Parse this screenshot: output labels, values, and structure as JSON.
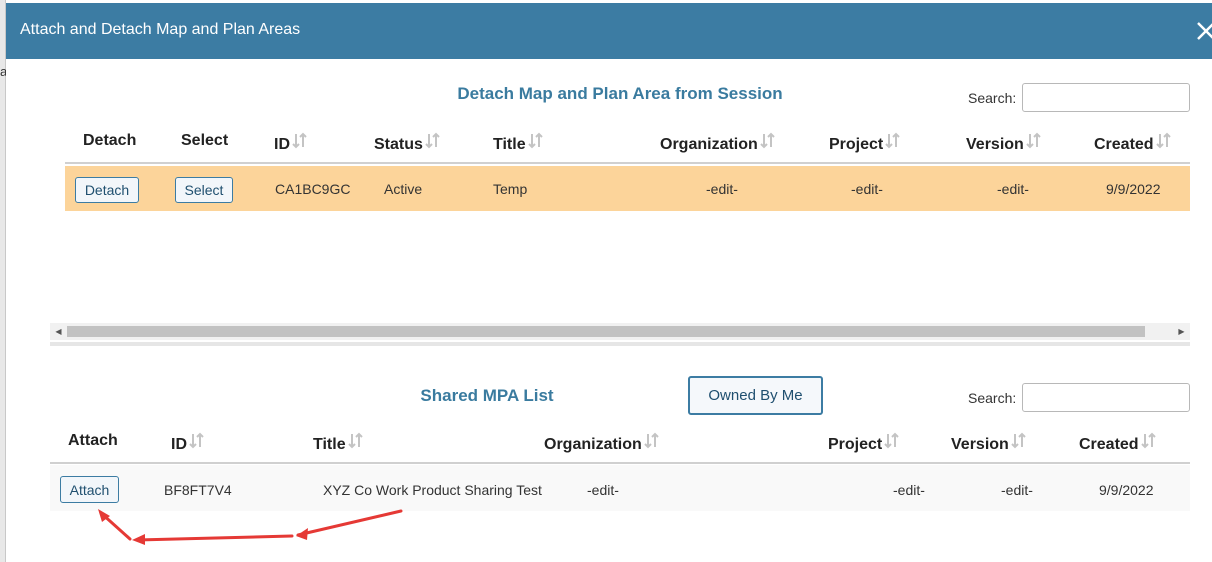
{
  "dialog": {
    "title": "Attach and Detach Map and Plan Areas"
  },
  "left_edge_glyph": "a",
  "detach_section": {
    "title": "Detach Map and Plan Area from Session",
    "search_label": "Search:",
    "search_value": "",
    "columns": [
      "Detach",
      "Select",
      "ID",
      "Status",
      "Title",
      "Organization",
      "Project",
      "Version",
      "Created"
    ],
    "rows": [
      {
        "detach_label": "Detach",
        "select_label": "Select",
        "id": "CA1BC9GC",
        "status": "Active",
        "title": "Temp",
        "organization": "-edit-",
        "project": "-edit-",
        "version": "-edit-",
        "created": "9/9/2022"
      }
    ],
    "highlight_color": "#fcd49a"
  },
  "shared_section": {
    "title": "Shared MPA List",
    "owned_by_me_label": "Owned By Me",
    "search_label": "Search:",
    "search_value": "",
    "columns": [
      "Attach",
      "ID",
      "Title",
      "Organization",
      "Project",
      "Version",
      "Created"
    ],
    "rows": [
      {
        "attach_label": "Attach",
        "id": "BF8FT7V4",
        "title": "XYZ Co Work Product Sharing Test",
        "organization": "-edit-",
        "project": "-edit-",
        "version": "-edit-",
        "created": "9/9/2022"
      }
    ]
  },
  "icons": {
    "close": "close-icon",
    "sort": "sort-icon",
    "scroll_left": "chevron-left-icon",
    "scroll_right": "chevron-right-icon",
    "annotation": "red-arrow-annotation"
  },
  "colors": {
    "header_bg": "#3c7ca3",
    "section_title": "#3a7b9f",
    "annotation_red": "#e53935"
  }
}
